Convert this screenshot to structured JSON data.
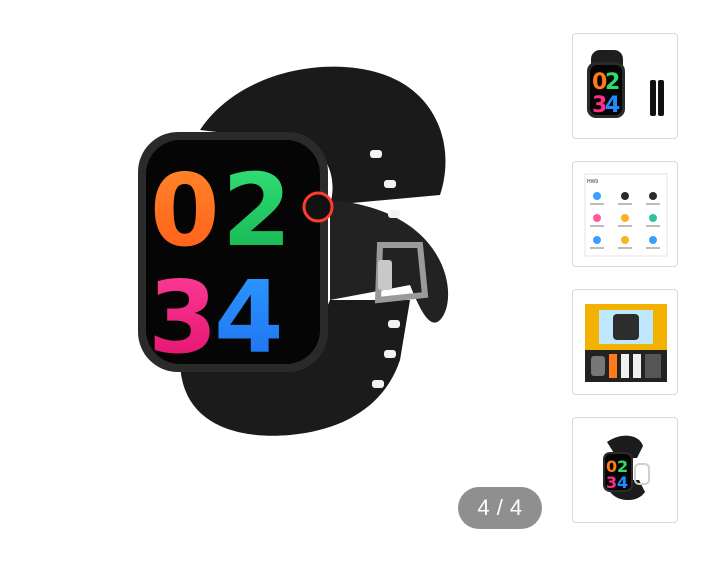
{
  "gallery": {
    "counter_text": "4 / 4",
    "main_watch_digits": [
      "0",
      "2",
      "3",
      "4"
    ],
    "thumbnails": [
      {
        "name": "thumb-1",
        "alt": "Black smartwatch front with band"
      },
      {
        "name": "thumb-2",
        "alt": "Feature overview sheet"
      },
      {
        "name": "thumb-3",
        "alt": "Watch box with straps"
      },
      {
        "name": "thumb-4",
        "alt": "Black smartwatch angled"
      }
    ],
    "thumb2_heading": "HW9"
  },
  "colors": {
    "accent_digit_0": "#ff7a1a",
    "accent_digit_2": "#2fdc6a",
    "accent_digit_3": "#ff2d8a",
    "accent_digit_4": "#1f8bff",
    "counter_bg": "#8f8f8f"
  }
}
